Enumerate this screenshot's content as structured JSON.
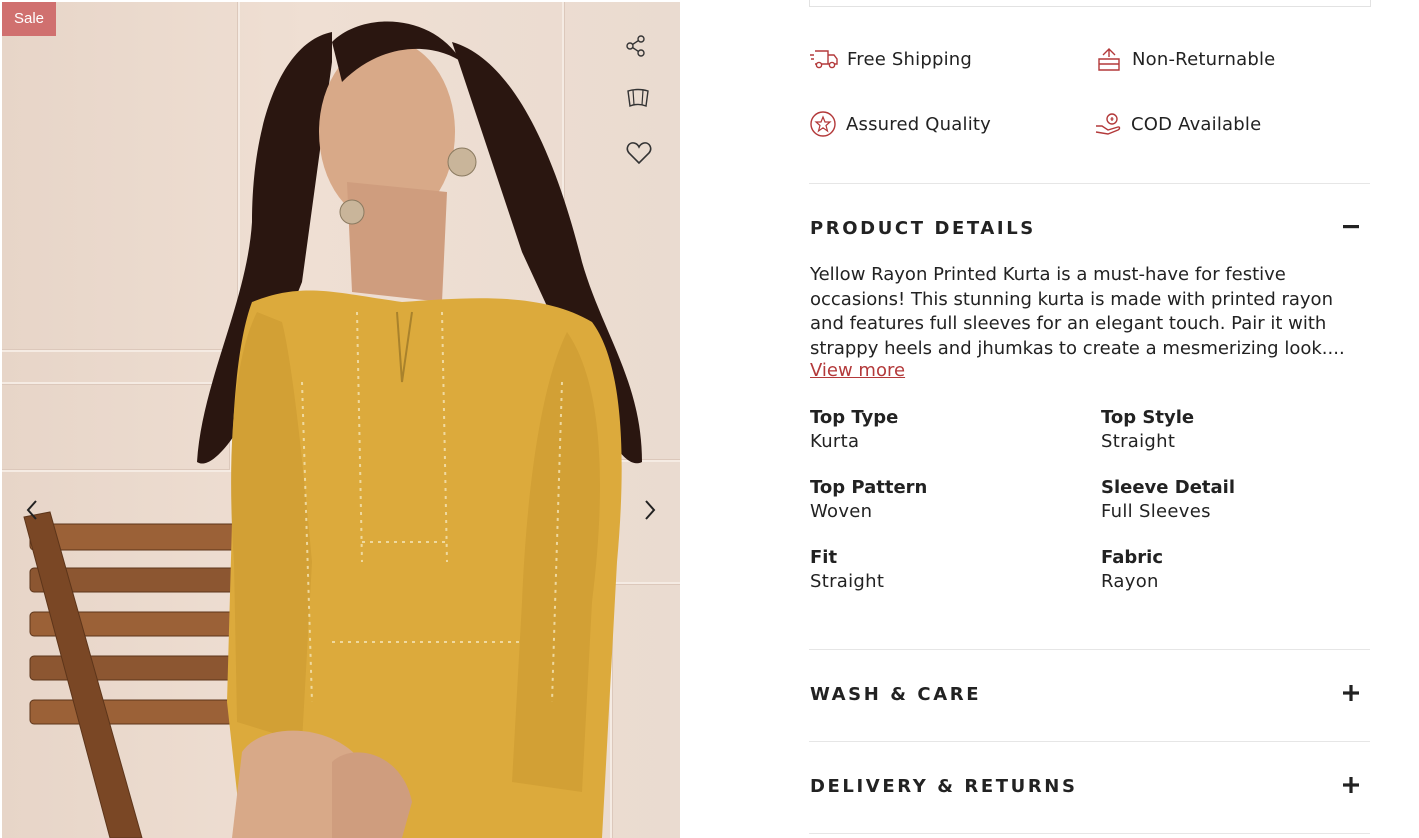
{
  "gallery": {
    "sale_badge": "Sale",
    "tools": [
      "share-icon",
      "size-chart-icon",
      "wishlist-heart-icon"
    ],
    "prev_icon": "chevron-left-icon",
    "next_icon": "chevron-right-icon"
  },
  "features": [
    {
      "icon": "delivery-truck-icon",
      "label": "Free Shipping"
    },
    {
      "icon": "return-box-icon",
      "label": "Non-Returnable"
    },
    {
      "icon": "quality-star-icon",
      "label": "Assured Quality"
    },
    {
      "icon": "cash-hand-icon",
      "label": "COD Available"
    }
  ],
  "product_details": {
    "title": "PRODUCT DETAILS",
    "toggle": "−",
    "description": "Yellow Rayon Printed Kurta is a must-have for festive occasions! This stunning kurta is made with printed rayon and features full sleeves for an elegant touch. Pair it with strappy heels and jhumkas to create a mesmerizing look....",
    "view_more": "View more",
    "attributes": [
      {
        "key": "Top Type",
        "value": "Kurta"
      },
      {
        "key": "Top Style",
        "value": "Straight"
      },
      {
        "key": "Top Pattern",
        "value": "Woven"
      },
      {
        "key": "Sleeve Detail",
        "value": "Full Sleeves"
      },
      {
        "key": "Fit",
        "value": "Straight"
      },
      {
        "key": "Fabric",
        "value": "Rayon"
      }
    ]
  },
  "wash_care": {
    "title": "WASH & CARE",
    "toggle": "+"
  },
  "delivery_returns": {
    "title": "DELIVERY & RETURNS",
    "toggle": "+"
  },
  "colors": {
    "accent": "#b3393a",
    "sale": "#d0706f",
    "kurta": "#dcaa3c"
  }
}
